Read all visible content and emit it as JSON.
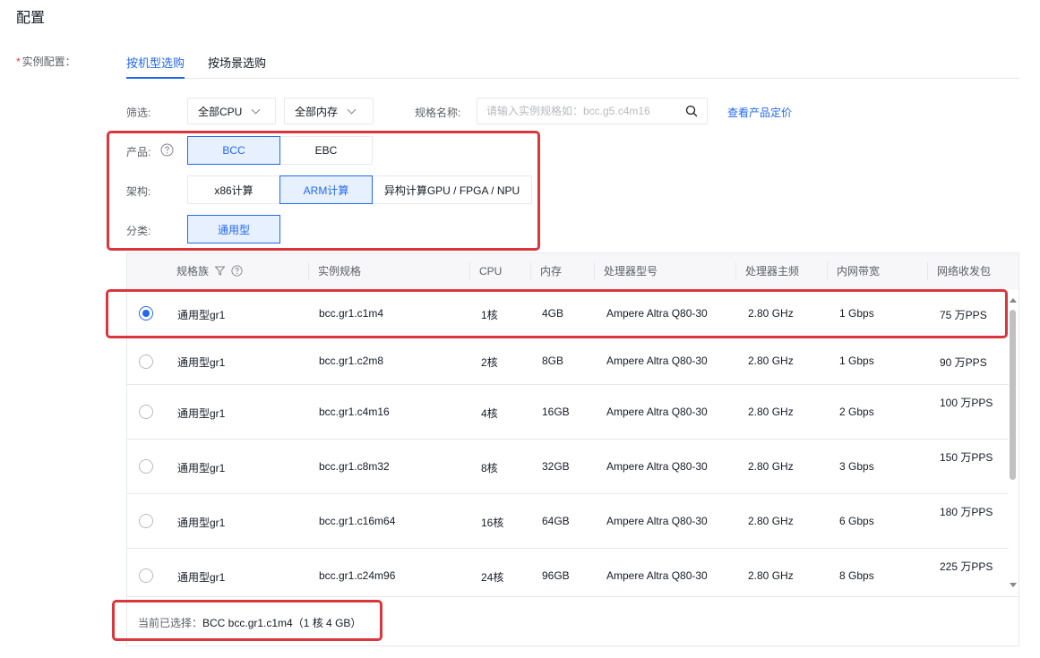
{
  "page": {
    "title": "配置"
  },
  "field": {
    "required_mark": "*",
    "label": "实例配置："
  },
  "tabs": [
    {
      "label": "按机型选购",
      "active": true
    },
    {
      "label": "按场景选购",
      "active": false
    }
  ],
  "filter": {
    "label": "筛选:",
    "cpu_select": "全部CPU",
    "memory_select": "全部内存",
    "spec_name_label": "规格名称:",
    "search_placeholder": "请输入实例规格如：bcc.g5.c4m16",
    "pricing_link": "查看产品定价"
  },
  "product": {
    "label": "产品:",
    "options": [
      "BCC",
      "EBC"
    ],
    "selected": "BCC"
  },
  "arch": {
    "label": "架构:",
    "options": [
      "x86计算",
      "ARM计算",
      "异构计算GPU / FPGA / NPU"
    ],
    "selected": "ARM计算"
  },
  "category": {
    "label": "分类:",
    "options": [
      "通用型"
    ],
    "selected": "通用型"
  },
  "table": {
    "columns": [
      "规格族",
      "实例规格",
      "CPU",
      "内存",
      "处理器型号",
      "处理器主频",
      "内网带宽",
      "网络收发包"
    ],
    "rows": [
      {
        "family": "通用型gr1",
        "spec": "bcc.gr1.c1m4",
        "cpu": "1核",
        "mem": "4GB",
        "processor": "Ampere Altra Q80-30",
        "freq": "2.80 GHz",
        "bandwidth": "1 Gbps",
        "pps": "75 万PPS",
        "selected": true
      },
      {
        "family": "通用型gr1",
        "spec": "bcc.gr1.c2m8",
        "cpu": "2核",
        "mem": "8GB",
        "processor": "Ampere Altra Q80-30",
        "freq": "2.80 GHz",
        "bandwidth": "1 Gbps",
        "pps": "90 万PPS",
        "selected": false
      },
      {
        "family": "通用型gr1",
        "spec": "bcc.gr1.c4m16",
        "cpu": "4核",
        "mem": "16GB",
        "processor": "Ampere Altra Q80-30",
        "freq": "2.80 GHz",
        "bandwidth": "2 Gbps",
        "pps": "100 万PPS",
        "selected": false
      },
      {
        "family": "通用型gr1",
        "spec": "bcc.gr1.c8m32",
        "cpu": "8核",
        "mem": "32GB",
        "processor": "Ampere Altra Q80-30",
        "freq": "2.80 GHz",
        "bandwidth": "3 Gbps",
        "pps": "150 万PPS",
        "selected": false
      },
      {
        "family": "通用型gr1",
        "spec": "bcc.gr1.c16m64",
        "cpu": "16核",
        "mem": "64GB",
        "processor": "Ampere Altra Q80-30",
        "freq": "2.80 GHz",
        "bandwidth": "6 Gbps",
        "pps": "180 万PPS",
        "selected": false
      },
      {
        "family": "通用型gr1",
        "spec": "bcc.gr1.c24m96",
        "cpu": "24核",
        "mem": "96GB",
        "processor": "Ampere Altra Q80-30",
        "freq": "2.80 GHz",
        "bandwidth": "8 Gbps",
        "pps": "225 万PPS",
        "selected": false
      }
    ]
  },
  "footer": {
    "label": "当前已选择：",
    "value": "BCC bcc.gr1.c1m4（1 核 4 GB）"
  },
  "colors": {
    "primary": "#2468f2",
    "selected_bg": "#e6f0ff",
    "highlight": "#d9363e",
    "border": "#e8e9eb"
  },
  "icons": {
    "search": "search-icon",
    "help": "question-circle-icon",
    "filter": "funnel-icon",
    "dropdown": "chevron-down-icon"
  }
}
